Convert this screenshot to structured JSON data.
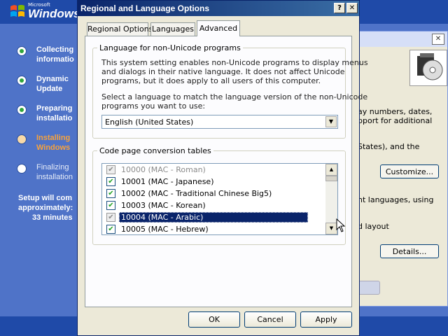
{
  "setup": {
    "logo_ms": "Microsoft",
    "logo_windows": "Windows",
    "steps": [
      {
        "label1": "Collecting",
        "label2": "informatio",
        "state": "done"
      },
      {
        "label1": "Dynamic",
        "label2": "Update",
        "state": "done"
      },
      {
        "label1": "Preparing",
        "label2": "installatio",
        "state": "done"
      },
      {
        "label1": "Installing",
        "label2": "Windows",
        "state": "current"
      },
      {
        "label1": "Finalizing",
        "label2": "installation",
        "state": "pending"
      }
    ],
    "time_line1": "Setup will com",
    "time_line2": "approximately:",
    "time_line3": "33 minutes"
  },
  "bg_window": {
    "text1a": "ay numbers, dates,",
    "text1b": "pport for additional",
    "text2": "States), and the",
    "customize_label": "Customize...",
    "text3": "nt languages, using",
    "text4": "d layout",
    "details_label": "Details..."
  },
  "dialog": {
    "title": "Regional and Language Options",
    "help_glyph": "?",
    "close_glyph": "✕",
    "tabs": {
      "regional": "Regional Options",
      "languages": "Languages",
      "advanced": "Advanced"
    },
    "nonunicode": {
      "legend": "Language for non-Unicode programs",
      "desc_line1": "This system setting enables non-Unicode programs to display menus",
      "desc_line2": "and dialogs in their native language. It does not affect Unicode",
      "desc_line3": "programs, but it does apply to all users of this computer.",
      "select_line1": "Select a language to match the language version of the non-Unicode",
      "select_line2": "programs you want to use:",
      "selected_language": "English (United States)"
    },
    "codepage": {
      "legend": "Code page conversion tables",
      "rows": [
        {
          "label": "10000 (MAC - Roman)",
          "checked": true,
          "disabled": true,
          "selected": false
        },
        {
          "label": "10001 (MAC - Japanese)",
          "checked": true,
          "disabled": false,
          "selected": false
        },
        {
          "label": "10002 (MAC - Traditional Chinese Big5)",
          "checked": true,
          "disabled": false,
          "selected": false
        },
        {
          "label": "10003 (MAC - Korean)",
          "checked": true,
          "disabled": false,
          "selected": false
        },
        {
          "label": "10004 (MAC - Arabic)",
          "checked": true,
          "disabled": true,
          "selected": true
        },
        {
          "label": "10005 (MAC - Hebrew)",
          "checked": true,
          "disabled": false,
          "selected": false
        }
      ]
    },
    "buttons": {
      "ok": "OK",
      "cancel": "Cancel",
      "apply": "Apply"
    }
  },
  "colors": {
    "setup_blue": "#4f73c8",
    "title_bar": "#0a246a",
    "selection": "#0a246a",
    "check_green": "#21a121",
    "installing_orange": "#f7a23c"
  }
}
